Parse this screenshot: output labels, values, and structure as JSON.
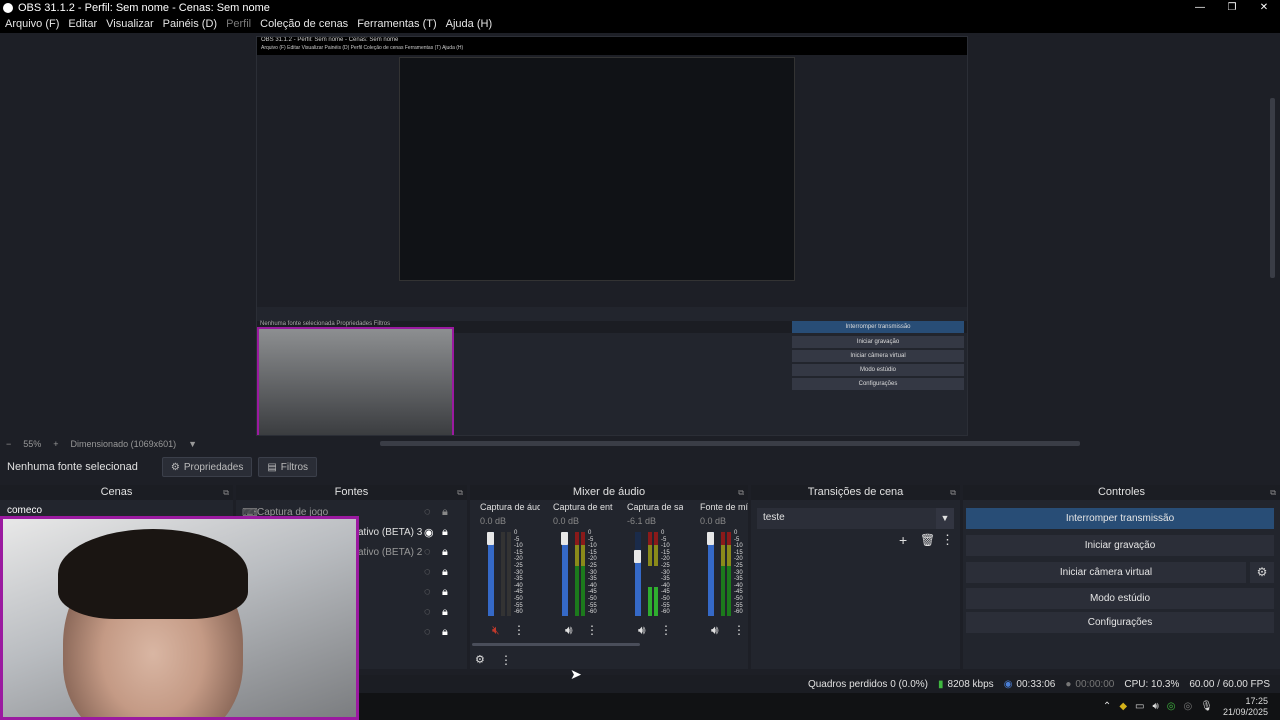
{
  "window": {
    "title": "OBS 31.1.2 - Perfil: Sem nome - Cenas: Sem nome"
  },
  "menu": [
    {
      "label": "Arquivo (F)"
    },
    {
      "label": "Editar"
    },
    {
      "label": "Visualizar"
    },
    {
      "label": "Painéis (D)"
    },
    {
      "label": "Perfil"
    },
    {
      "label": "Coleção de cenas"
    },
    {
      "label": "Ferramentas (T)"
    },
    {
      "label": "Ajuda (H)"
    }
  ],
  "zoom": {
    "minus": "−",
    "value": "55%",
    "plus": "+",
    "mode": "Dimensionado (1069x601)"
  },
  "toolbar": {
    "no_source": "Nenhuma fonte selecionad",
    "properties": "Propriedades",
    "filters": "Filtros"
  },
  "docks": {
    "scenes": {
      "title": "Cenas",
      "items": [
        "comeco"
      ]
    },
    "sources": {
      "title": "Fontes",
      "items": [
        "Captura de jogo",
        "ativo (BETA) 3",
        "ativo (BETA) 2"
      ]
    },
    "mixer": {
      "title": "Mixer de áudio",
      "channels": [
        {
          "name": "Captura de áudi",
          "db": "0.0 dB",
          "muted": true
        },
        {
          "name": "Captura de entra",
          "db": "0.0 dB",
          "muted": false
        },
        {
          "name": "Captura de saída",
          "db": "-6.1 dB",
          "muted": false
        },
        {
          "name": "Fonte de mídi",
          "db": "0.0 dB",
          "muted": false
        }
      ],
      "scale": [
        "0",
        "-5",
        "-10",
        "-15",
        "-20",
        "-25",
        "-30",
        "-35",
        "-40",
        "-45",
        "-50",
        "-55",
        "-60"
      ]
    },
    "transitions": {
      "title": "Transições de cena",
      "selected": "teste"
    },
    "controls": {
      "title": "Controles",
      "buttons": [
        "Interromper transmissão",
        "Iniciar gravação",
        "Iniciar câmera virtual",
        "Modo estúdio",
        "Configurações"
      ]
    }
  },
  "nested": {
    "title": "OBS 31.1.2 - Perfil: Sem nome - Cenas: Sem nome",
    "menu": "Arquivo (F)   Editar   Visualizar   Painéis (D)   Perfil   Coleção de cenas   Ferramentas (T)   Ajuda (H)",
    "bar": "Nenhuma fonte selecionada    Propriedades    Filtros",
    "controls": [
      "Interromper transmissão",
      "Iniciar gravação",
      "Iniciar câmera virtual",
      "Modo estúdio",
      "Configurações"
    ]
  },
  "status": {
    "dropped": "Quadros perdidos 0 (0.0%)",
    "bitrate": "8208 kbps",
    "stream_time": "00:33:06",
    "rec_time": "00:00:00",
    "cpu": "CPU: 10.3%",
    "fps": "60.00 / 60.00 FPS"
  },
  "taskbar": {
    "time": "17:25",
    "date": "21/09/2025"
  },
  "colors": {
    "accent": "#284d76",
    "border_webcam": "#9b1aa0",
    "meter_blue": "#3569c7"
  }
}
